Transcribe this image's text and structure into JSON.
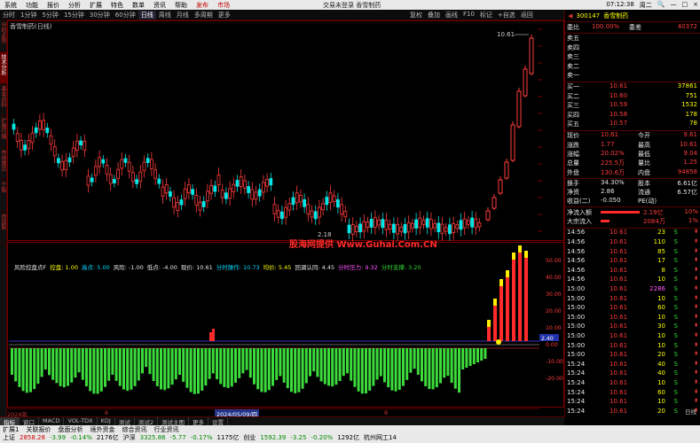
{
  "menubar": {
    "items": [
      "系统",
      "功能",
      "报价",
      "分析",
      "扩展",
      "特色",
      "数单",
      "资讯",
      "帮助"
    ],
    "hot_items": [
      "发布",
      "市场"
    ],
    "title": "交易未登录  香雪制药",
    "right": [
      "07:12:38",
      "周二",
      "🔍",
      "—",
      "□",
      "×"
    ]
  },
  "timebar": {
    "periods": [
      "分时",
      "1分钟",
      "5分钟",
      "15分钟",
      "30分钟",
      "60分钟",
      "日线",
      "周线",
      "月线",
      "多周期",
      "更多"
    ],
    "active": "日线",
    "tools": [
      "复权",
      "叠加",
      "画线",
      "F10",
      "标记",
      "+自选",
      "返回"
    ]
  },
  "sidebar": {
    "tabs": [
      "分时走势",
      "技术分析",
      "基本资料",
      "扩展行情",
      "市场雷达",
      "个股",
      "自选股"
    ],
    "active": "技术分析"
  },
  "chart": {
    "stock_title": "香雪制药(日线)",
    "high_label": "10.61",
    "low_label": "2.18",
    "indicator_line": [
      {
        "t": "风险控盘点F",
        "c": "white"
      },
      {
        "t": "控盘: 1.00",
        "c": "yellow"
      },
      {
        "t": "高点: 5.00",
        "c": "cyan"
      },
      {
        "t": "风险: -1.00",
        "c": "white"
      },
      {
        "t": "低点: -4.00",
        "c": "white"
      },
      {
        "t": "现价: 10.61",
        "c": "white"
      },
      {
        "t": "分时操作: 10.73",
        "c": "cyan"
      },
      {
        "t": "均价: 5.45",
        "c": "yellow"
      },
      {
        "t": "回调认同: 4.45",
        "c": "white"
      },
      {
        "t": "分时压力: 9.32",
        "c": "magenta"
      },
      {
        "t": "分时支撑: 3.20",
        "c": "green"
      }
    ],
    "watermark": "股海网提供 Www.Guhai.Com.CN",
    "sub_y_labels": [
      "50.00",
      "40.00",
      "30.00",
      "20.00",
      "10.00",
      "0.00",
      "-10.00",
      "-20.00"
    ],
    "current_label": "2.40",
    "dates": [
      "2024年",
      "6",
      "7",
      "8"
    ],
    "date_highlight": "2024/05/09/四"
  },
  "sub_tabs": [
    "指标",
    "窗口",
    "MACD",
    "VOL-TDX",
    "KDJ",
    "测试",
    "测试2",
    "测试主图",
    "更多",
    "设置"
  ],
  "rpanel": {
    "code": "300147",
    "name": "香雪制药",
    "weibi_label": "委比",
    "weibi": "100.00%",
    "weicha_label": "委差",
    "weicha": "40372",
    "asks": [
      {
        "l": "卖五",
        "p": "",
        "v": ""
      },
      {
        "l": "卖四",
        "p": "",
        "v": ""
      },
      {
        "l": "卖三",
        "p": "",
        "v": ""
      },
      {
        "l": "卖二",
        "p": "",
        "v": ""
      },
      {
        "l": "卖一",
        "p": "",
        "v": ""
      }
    ],
    "bids": [
      {
        "l": "买一",
        "p": "10.61",
        "v": "37861"
      },
      {
        "l": "买二",
        "p": "10.60",
        "v": "751"
      },
      {
        "l": "买三",
        "p": "10.59",
        "v": "1532"
      },
      {
        "l": "买四",
        "p": "10.58",
        "v": "178"
      },
      {
        "l": "买五",
        "p": "10.57",
        "v": "78"
      }
    ],
    "quote": [
      {
        "a": "现价",
        "b": "10.61",
        "c": "今开",
        "d": "9.61"
      },
      {
        "a": "涨跌",
        "b": "1.77",
        "c": "最高",
        "d": "10.61"
      },
      {
        "a": "涨幅",
        "b": "20.02%",
        "c": "最低",
        "d": "9.04"
      },
      {
        "a": "总量",
        "b": "225.5万",
        "c": "量比",
        "d": "1.25"
      },
      {
        "a": "外盘",
        "b": "130.6万",
        "c": "内盘",
        "d": "94858"
      }
    ],
    "quote2": [
      {
        "a": "换手",
        "b": "34.30%",
        "c": "股本",
        "d": "6.61亿"
      },
      {
        "a": "净资",
        "b": "2.86",
        "c": "流通",
        "d": "6.57亿"
      },
      {
        "a": "收益(二)",
        "b": "-0.050",
        "c": "PE(动)",
        "d": ""
      }
    ],
    "flow": [
      {
        "a": "净流入额",
        "b": "2.19亿",
        "c": "10%"
      },
      {
        "a": "大宗流入",
        "b": "2084万",
        "c": "1%"
      }
    ],
    "ticks": [
      {
        "t": "14:56",
        "p": "10.61",
        "v": "23",
        "s": "S"
      },
      {
        "t": "14:56",
        "p": "10.61",
        "v": "110",
        "s": "S"
      },
      {
        "t": "14:56",
        "p": "10.61",
        "v": "85",
        "s": "S"
      },
      {
        "t": "14:56",
        "p": "10.61",
        "v": "17",
        "s": "S"
      },
      {
        "t": "14:56",
        "p": "10.61",
        "v": "8",
        "s": "S"
      },
      {
        "t": "14:56",
        "p": "10.61",
        "v": "10",
        "s": "S"
      },
      {
        "t": "15:00",
        "p": "10.61",
        "v": "2286",
        "s": "S"
      },
      {
        "t": "15:00",
        "p": "10.61",
        "v": "10",
        "s": "S"
      },
      {
        "t": "15:00",
        "p": "10.61",
        "v": "60",
        "s": "S"
      },
      {
        "t": "15:00",
        "p": "10.61",
        "v": "10",
        "s": "S"
      },
      {
        "t": "15:00",
        "p": "10.61",
        "v": "30",
        "s": "S"
      },
      {
        "t": "15:00",
        "p": "10.61",
        "v": "10",
        "s": "S"
      },
      {
        "t": "15:00",
        "p": "10.61",
        "v": "10",
        "s": "S"
      },
      {
        "t": "15:00",
        "p": "10.61",
        "v": "20",
        "s": "S"
      },
      {
        "t": "15:24",
        "p": "10.61",
        "v": "40",
        "s": "S"
      },
      {
        "t": "15:24",
        "p": "10.61",
        "v": "40",
        "s": "S"
      },
      {
        "t": "15:24",
        "p": "10.61",
        "v": "10",
        "s": "S"
      },
      {
        "t": "15:24",
        "p": "10.61",
        "v": "60",
        "s": "S"
      },
      {
        "t": "15:24",
        "p": "10.61",
        "v": "10",
        "s": "S"
      },
      {
        "t": "15:24",
        "p": "10.61",
        "v": "20",
        "s": "S"
      }
    ],
    "ticks_tab": "日线"
  },
  "statusbar": {
    "row1": [
      "扩展1",
      "关联报价",
      "盘面分析",
      "境外资金",
      "综合资讯",
      "行业资讯"
    ],
    "row2": [
      {
        "t": "上证",
        "c": "k"
      },
      {
        "t": "2858.28",
        "c": "r"
      },
      {
        "t": "-3.99",
        "c": "g"
      },
      {
        "t": "-0.14%",
        "c": "g"
      },
      {
        "t": "2176亿",
        "c": "k"
      },
      {
        "t": "沪深",
        "c": "k"
      },
      {
        "t": "3325.86",
        "c": "g"
      },
      {
        "t": "-5.77",
        "c": "g"
      },
      {
        "t": "-0.17%",
        "c": "g"
      },
      {
        "t": "1175亿",
        "c": "k"
      },
      {
        "t": "创业",
        "c": "k"
      },
      {
        "t": "1592.39",
        "c": "g"
      },
      {
        "t": "-3.25",
        "c": "g"
      },
      {
        "t": "-0.20%",
        "c": "g"
      },
      {
        "t": "1292亿",
        "c": "k"
      }
    ],
    "location": "杭州网工14"
  }
}
